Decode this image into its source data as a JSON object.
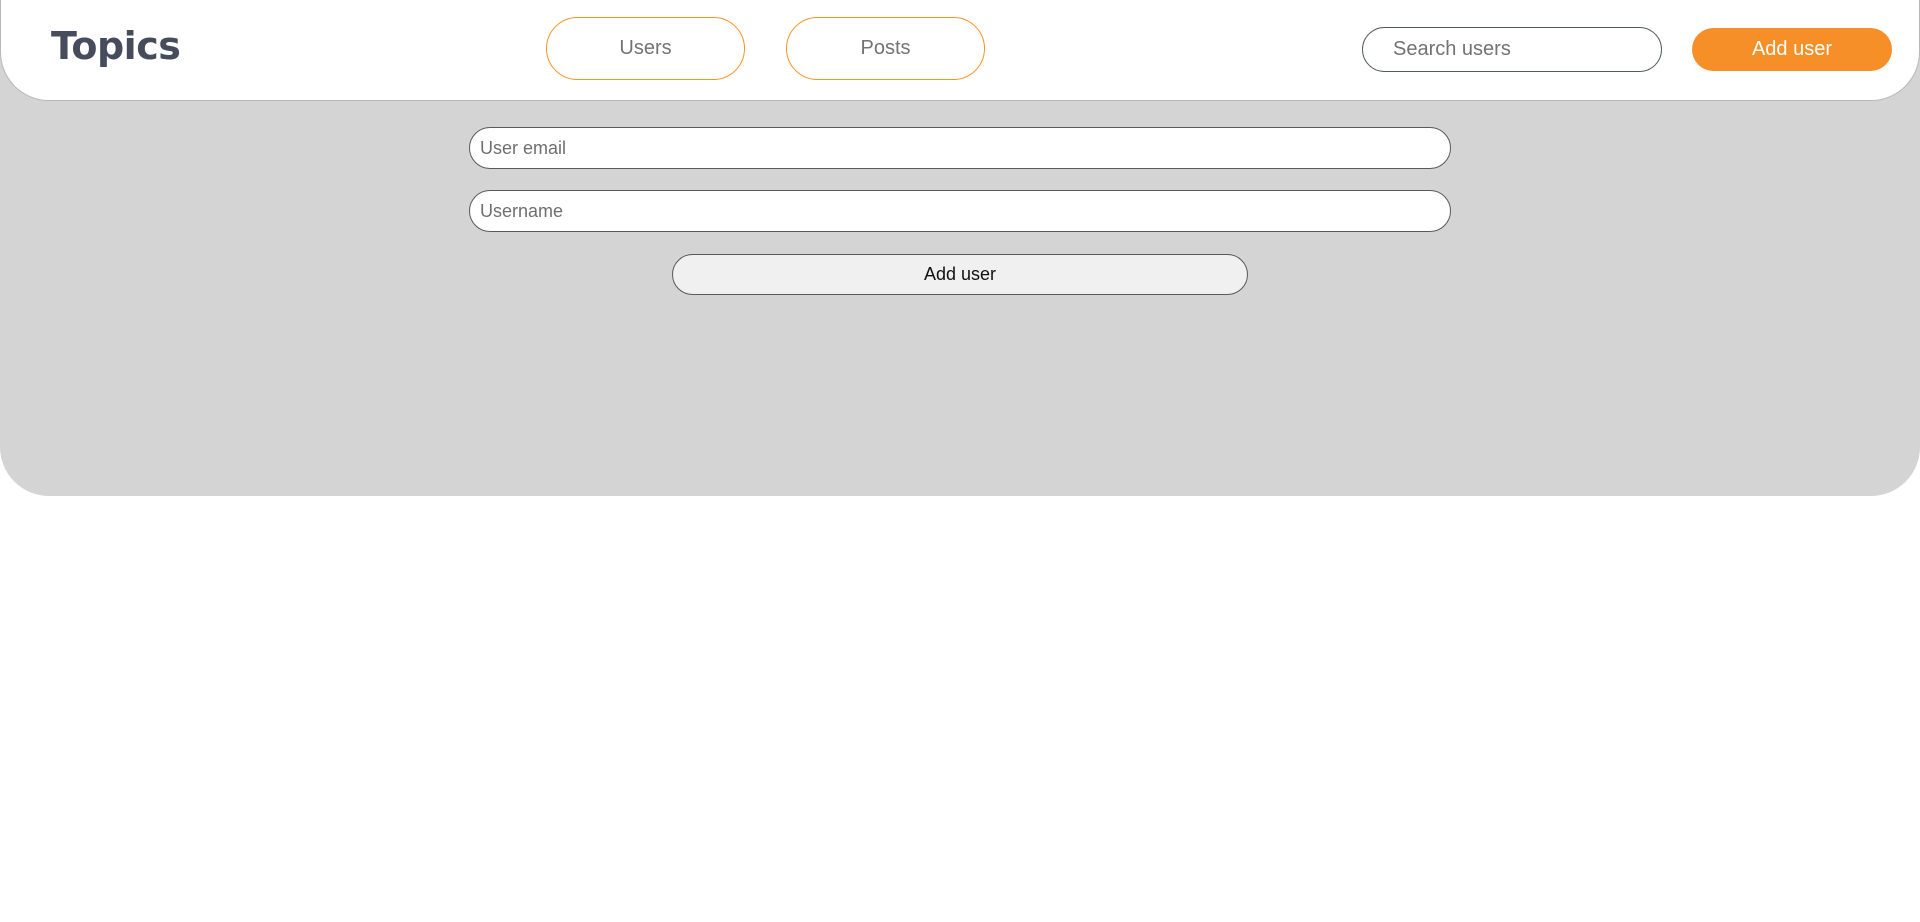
{
  "header": {
    "logo": "Topics",
    "nav": {
      "users_label": "Users",
      "posts_label": "Posts"
    },
    "search": {
      "placeholder": "Search users",
      "value": ""
    },
    "add_user_label": "Add user"
  },
  "form": {
    "email": {
      "placeholder": "User email",
      "value": ""
    },
    "username": {
      "placeholder": "Username",
      "value": ""
    },
    "submit_label": "Add user"
  },
  "colors": {
    "accent": "#f78f28",
    "panel_bg": "#d4d4d4",
    "logo_text": "#474c5c"
  }
}
